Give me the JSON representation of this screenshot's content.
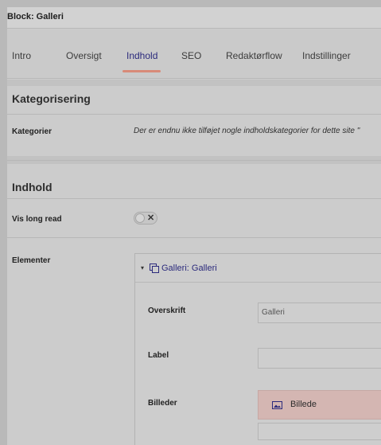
{
  "block": {
    "title": "Block: Galleri"
  },
  "tabs": [
    {
      "label": "Intro",
      "active": false
    },
    {
      "label": "Oversigt",
      "active": false
    },
    {
      "label": "Indhold",
      "active": true
    },
    {
      "label": "SEO",
      "active": false
    },
    {
      "label": "Redaktørflow",
      "active": false
    },
    {
      "label": "Indstillinger",
      "active": false
    }
  ],
  "categorization": {
    "title": "Kategorisering",
    "label": "Kategorier",
    "empty_text": "Der er endnu ikke tilføjet nogle indholdskategorier for dette site \""
  },
  "content": {
    "title": "Indhold",
    "long_read_label": "Vis long read",
    "long_read_enabled": false,
    "toggle_glyph": "✕",
    "elements_label": "Elementer"
  },
  "element": {
    "caret_icon": "caret-down-icon",
    "caret_glyph": "▾",
    "type_icon": "copy-icon",
    "title": "Galleri: Galleri",
    "fields": {
      "heading_label": "Overskrift",
      "heading_value": "Galleri",
      "label_label": "Label",
      "label_value": "",
      "images_label": "Billeder",
      "add_image_icon": "image-icon",
      "add_image_label": "Billede"
    }
  },
  "colors": {
    "accent": "#2b2a7c",
    "tab_underline": "#d88a78",
    "add_button": "#d4b6b2"
  }
}
